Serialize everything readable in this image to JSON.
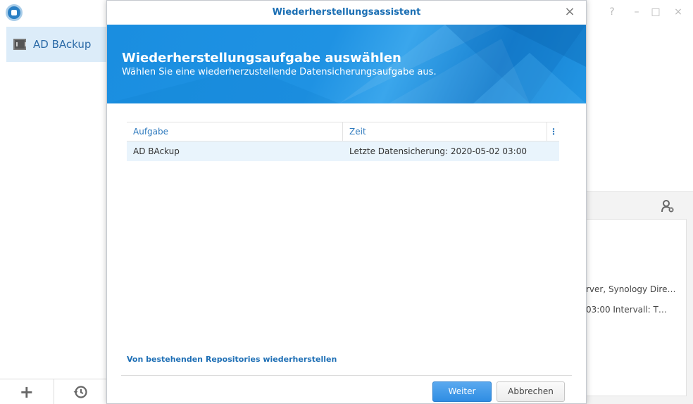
{
  "app": {
    "task_label": "AD BAckup",
    "right_panel": {
      "line1": "rver, Synology Dire…",
      "line2": " 03:00 Intervall: T…"
    }
  },
  "window_controls": {
    "help": "?",
    "minimize": "–",
    "maximize": "□",
    "close": "×"
  },
  "modal": {
    "title": "Wiederherstellungsassistent",
    "close_label": "×",
    "banner_title": "Wiederherstellungsaufgabe auswählen",
    "banner_subtitle": "Wählen Sie eine wiederherzustellende Datensicherungsaufgabe aus.",
    "table": {
      "columns": [
        "Aufgabe",
        "Zeit"
      ],
      "menu_glyph": "⋮",
      "rows": [
        {
          "task": "AD BAckup",
          "time": "Letzte Datensicherung: 2020-05-02 03:00"
        }
      ]
    },
    "repo_link": "Von bestehenden Repositories wiederherstellen",
    "next_button": "Weiter",
    "cancel_button": "Abbrechen"
  },
  "icons": {
    "add": "+",
    "history": "history-icon",
    "task": "nas-icon",
    "user_remove": "user-remove-icon"
  },
  "colors": {
    "accent": "#1b6fb4",
    "banner": "#1f92e3",
    "selected_row": "#e9f4fc",
    "primary_button": "#3a95e6"
  }
}
